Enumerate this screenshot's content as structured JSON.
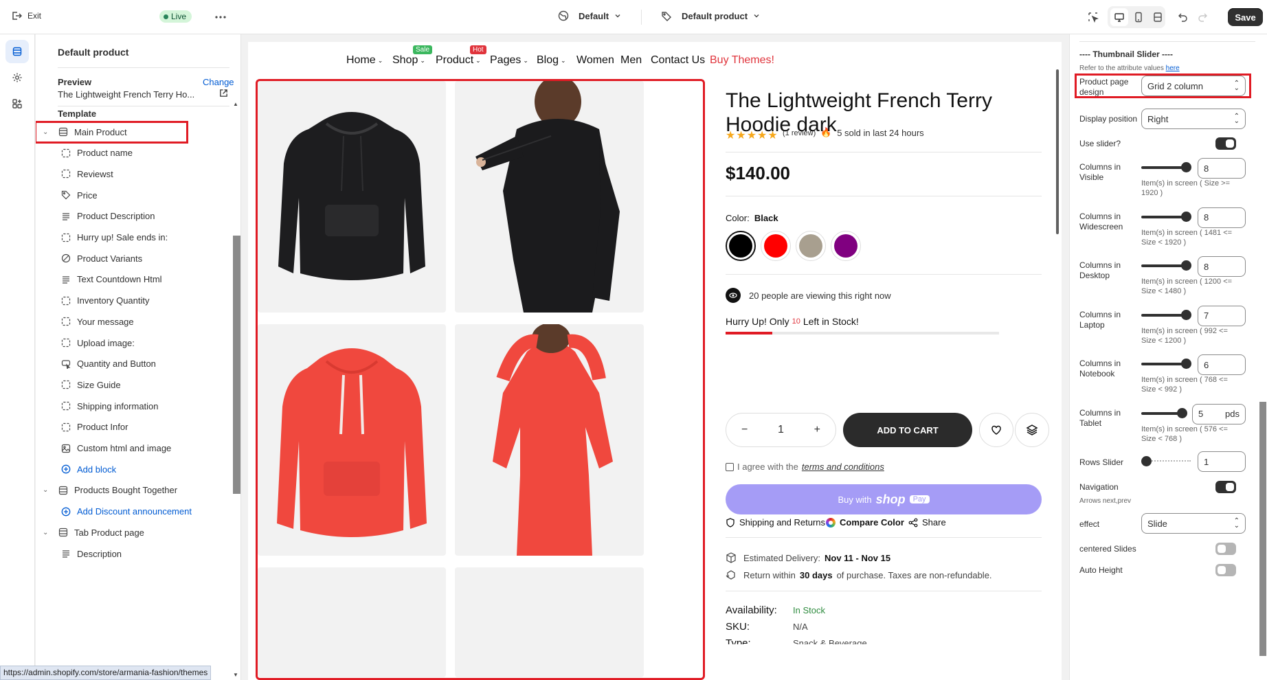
{
  "topbar": {
    "exit_label": "Exit",
    "live_label": "Live",
    "theme_select": "Default",
    "template_select": "Default product",
    "save_label": "Save"
  },
  "sidebar": {
    "title": "Default product",
    "preview_label": "Preview",
    "change_label": "Change",
    "preview_value": "The Lightweight French Terry Ho...",
    "template_label": "Template",
    "items": [
      {
        "label": "Main Product",
        "icon": "section-icon",
        "level": 0
      },
      {
        "label": "Product name",
        "icon": "block-icon",
        "level": 1
      },
      {
        "label": "Reviewst",
        "icon": "block-icon",
        "level": 1
      },
      {
        "label": "Price",
        "icon": "price-tag-icon",
        "level": 1
      },
      {
        "label": "Product Description",
        "icon": "text-lines-icon",
        "level": 1
      },
      {
        "label": "Hurry up! Sale ends in:",
        "icon": "block-icon",
        "level": 1
      },
      {
        "label": "Product Variants",
        "icon": "variants-icon",
        "level": 1
      },
      {
        "label": "Text Countdown Html",
        "icon": "text-lines-icon",
        "level": 1
      },
      {
        "label": "Inventory Quantity",
        "icon": "block-icon",
        "level": 1
      },
      {
        "label": "Your message",
        "icon": "block-icon",
        "level": 1
      },
      {
        "label": "Upload image:",
        "icon": "block-icon",
        "level": 1
      },
      {
        "label": "Quantity and Button",
        "icon": "cart-button-icon",
        "level": 1
      },
      {
        "label": "Size Guide",
        "icon": "block-icon",
        "level": 1
      },
      {
        "label": "Shipping information",
        "icon": "block-icon",
        "level": 1
      },
      {
        "label": "Product Infor",
        "icon": "block-icon",
        "level": 1
      },
      {
        "label": "Custom html and image",
        "icon": "image-icon",
        "level": 1
      },
      {
        "label": "Add block",
        "icon": "plus-circle-icon",
        "level": 1
      },
      {
        "label": "Products Bought Together",
        "icon": "section-icon",
        "level": 0
      },
      {
        "label": "Add Discount announcement",
        "icon": "plus-circle-icon",
        "level": 1
      },
      {
        "label": "Tab Product page",
        "icon": "section-icon",
        "level": 0
      },
      {
        "label": "Description",
        "icon": "text-lines-icon",
        "level": 1
      }
    ],
    "status_url": "https://admin.shopify.com/store/armania-fashion/themes"
  },
  "preview": {
    "nav": [
      {
        "label": "Home",
        "dropdown": true
      },
      {
        "label": "Shop",
        "dropdown": true,
        "badge": "Sale",
        "badge_color": "#3bb75e"
      },
      {
        "label": "Product",
        "dropdown": true,
        "badge": "Hot",
        "badge_color": "#e0343c"
      },
      {
        "label": "Pages",
        "dropdown": true
      },
      {
        "label": "Blog",
        "dropdown": true
      },
      {
        "label": "Women",
        "dropdown": false
      },
      {
        "label": "Men",
        "dropdown": false
      },
      {
        "label": "Contact Us",
        "dropdown": false
      },
      {
        "label": "Buy Themes!",
        "dropdown": false,
        "color": "#e0343c"
      }
    ],
    "product": {
      "title": "The Lightweight French Terry Hoodie dark",
      "rating": 5,
      "review_count": "(1 review)",
      "sold_text": "5 sold in last 24 hours",
      "price": "$140.00",
      "color_label": "Color:",
      "color_value": "Black",
      "swatches": [
        "#000000",
        "#ff0000",
        "#a89f8f",
        "#800080"
      ],
      "viewing_text": "20 people are viewing this right now",
      "hurry_prefix": "Hurry Up! Only",
      "hurry_count": "10",
      "hurry_suffix": "Left in Stock!",
      "stock_progress": 0.17,
      "quantity": "1",
      "add_to_cart": "ADD TO CART",
      "agree_prefix": "I agree with the",
      "agree_link": "terms and conditions",
      "buy_with": "Buy with",
      "shop_word": "shop",
      "pay_word": "Pay",
      "shipping_returns": "Shipping and Returns",
      "compare_color": "Compare Color",
      "share": "Share",
      "delivery_label": "Estimated Delivery:",
      "delivery_value": "Nov 11 - Nov 15",
      "return_prefix": "Return within",
      "return_days": "30 days",
      "return_suffix": "of purchase. Taxes are non-refundable.",
      "availability_label": "Availability:",
      "availability_value": "In Stock",
      "sku_label": "SKU:",
      "sku_value": "N/A",
      "type_label": "Type:",
      "type_value": "Snack & Beverage"
    }
  },
  "rpanel": {
    "heading": "---- Thumbnail Slider ----",
    "refer_text": "Refer to the attribute values",
    "refer_link": "here",
    "design_label": "Product page design",
    "design_value": "Grid 2 column",
    "position_label": "Display position",
    "position_value": "Right",
    "use_slider_label": "Use slider?",
    "columns": [
      {
        "label": "Columns in Visible",
        "value": "8",
        "help": "Item(s) in screen ( Size >= 1920 )"
      },
      {
        "label": "Columns in Widescreen",
        "value": "8",
        "help": "Item(s) in screen ( 1481 <= Size < 1920 )"
      },
      {
        "label": "Columns in Desktop",
        "value": "8",
        "help": "Item(s) in screen ( 1200 <= Size < 1480 )"
      },
      {
        "label": "Columns in Laptop",
        "value": "7",
        "help": "Item(s) in screen ( 992 <= Size < 1200 )"
      },
      {
        "label": "Columns in Notebook",
        "value": "6",
        "help": "Item(s) in screen ( 768 <= Size < 992 )"
      },
      {
        "label": "Columns in Tablet",
        "value": "5",
        "unit": "pds",
        "help": "Item(s) in screen ( 576 <= Size < 768 )"
      }
    ],
    "rows_label": "Rows Slider",
    "rows_value": "1",
    "navigation_label": "Navigation",
    "navigation_help": "Arrows next,prev",
    "effect_label": "effect",
    "effect_value": "Slide",
    "centered_label": "centered Slides",
    "autoheight_label": "Auto Height"
  }
}
